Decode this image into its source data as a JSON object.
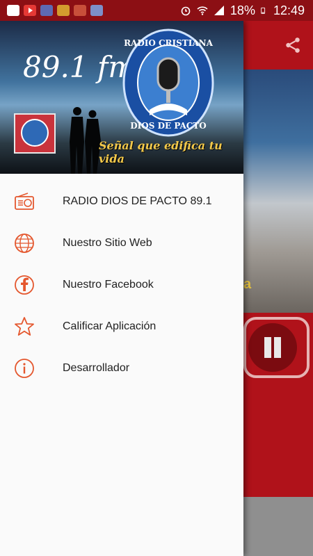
{
  "status_bar": {
    "battery": "18%",
    "time": "12:49",
    "icons": [
      "gallery-icon",
      "youtube-icon",
      "app-icon",
      "app-icon",
      "app-icon",
      "app-icon",
      "alarm-icon",
      "wifi-icon",
      "signal-icon",
      "battery-icon"
    ]
  },
  "drawer": {
    "header": {
      "frequency": "89.1 fm",
      "emblem_line1": "RADIO CRISTIANA",
      "emblem_line2": "DIOS DE PACTO",
      "tagline": "Señal que edifica tu vida"
    },
    "menu": [
      {
        "icon": "radio-icon",
        "label": "RADIO DIOS DE PACTO 89.1"
      },
      {
        "icon": "globe-www-icon",
        "label": "Nuestro Sitio Web"
      },
      {
        "icon": "facebook-icon",
        "label": "Nuestro Facebook"
      },
      {
        "icon": "star-icon",
        "label": "Calificar Aplicación"
      },
      {
        "icon": "info-icon",
        "label": "Desarrollador"
      }
    ]
  },
  "background_app": {
    "hero_text_fragment": "a"
  },
  "colors": {
    "accent": "#b0121a",
    "status_bar": "#8c0f14",
    "icon_orange": "#e4572e"
  }
}
